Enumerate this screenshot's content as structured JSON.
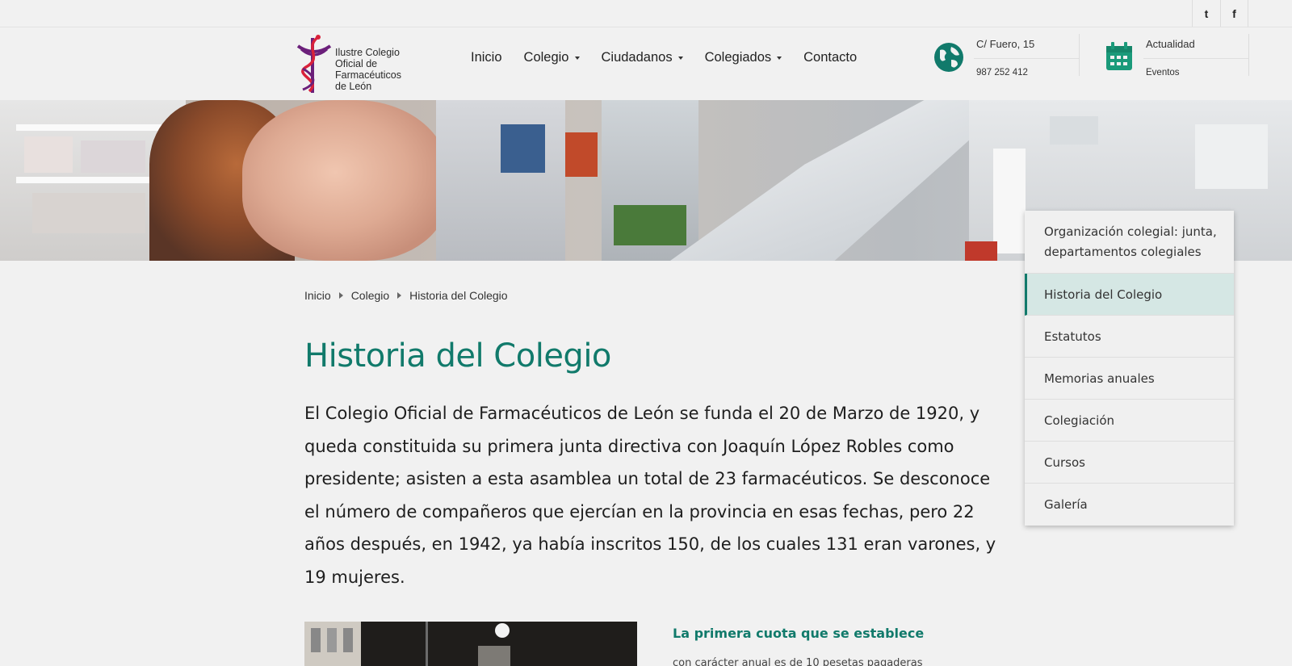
{
  "social": {
    "twitter_glyph": "t",
    "facebook_glyph": "f"
  },
  "logo": {
    "line1": "Ilustre Colegio",
    "line2": "Oficial de",
    "line3": "Farmacéuticos",
    "line4": "de León"
  },
  "nav": {
    "items": [
      {
        "label": "Inicio",
        "dropdown": false
      },
      {
        "label": "Colegio",
        "dropdown": true
      },
      {
        "label": "Ciudadanos",
        "dropdown": true
      },
      {
        "label": "Colegiados",
        "dropdown": true
      },
      {
        "label": "Contacto",
        "dropdown": false
      }
    ]
  },
  "contact": {
    "address": "C/ Fuero, 15",
    "phone": "987 252 412"
  },
  "news": {
    "title": "Actualidad",
    "subtitle": "Eventos"
  },
  "breadcrumb": [
    "Inicio",
    "Colegio",
    "Historia del Colegio"
  ],
  "page": {
    "title": "Historia del Colegio",
    "lead": "El Colegio Oficial de Farmacéuticos de León se funda el 20 de Marzo de 1920, y queda constituida su primera junta directiva con Joaquín López Robles como presidente; asisten a esta asamblea un total de 23 farmacéuticos. Se desconoce el número de compañeros que ejercían en la provincia en esas fechas, pero 22 años después, en 1942, ya había inscritos 150, de los cuales 131 eran varones, y 19 mujeres.",
    "subhead": "La primera cuota que se establece",
    "subtext": "con carácter anual es de 10 pesetas pagaderas"
  },
  "sidemenu": {
    "items": [
      {
        "label": "Organización colegial: junta, departamentos colegiales",
        "active": false
      },
      {
        "label": "Historia del Colegio",
        "active": true
      },
      {
        "label": "Estatutos",
        "active": false
      },
      {
        "label": "Memorias anuales",
        "active": false
      },
      {
        "label": "Colegiación",
        "active": false
      },
      {
        "label": "Cursos",
        "active": false
      },
      {
        "label": "Galería",
        "active": false
      }
    ]
  },
  "colors": {
    "accent": "#117a6b",
    "active_bg": "#d5e7e4",
    "logo_purple": "#6b1f7a",
    "logo_red": "#d9213a"
  }
}
